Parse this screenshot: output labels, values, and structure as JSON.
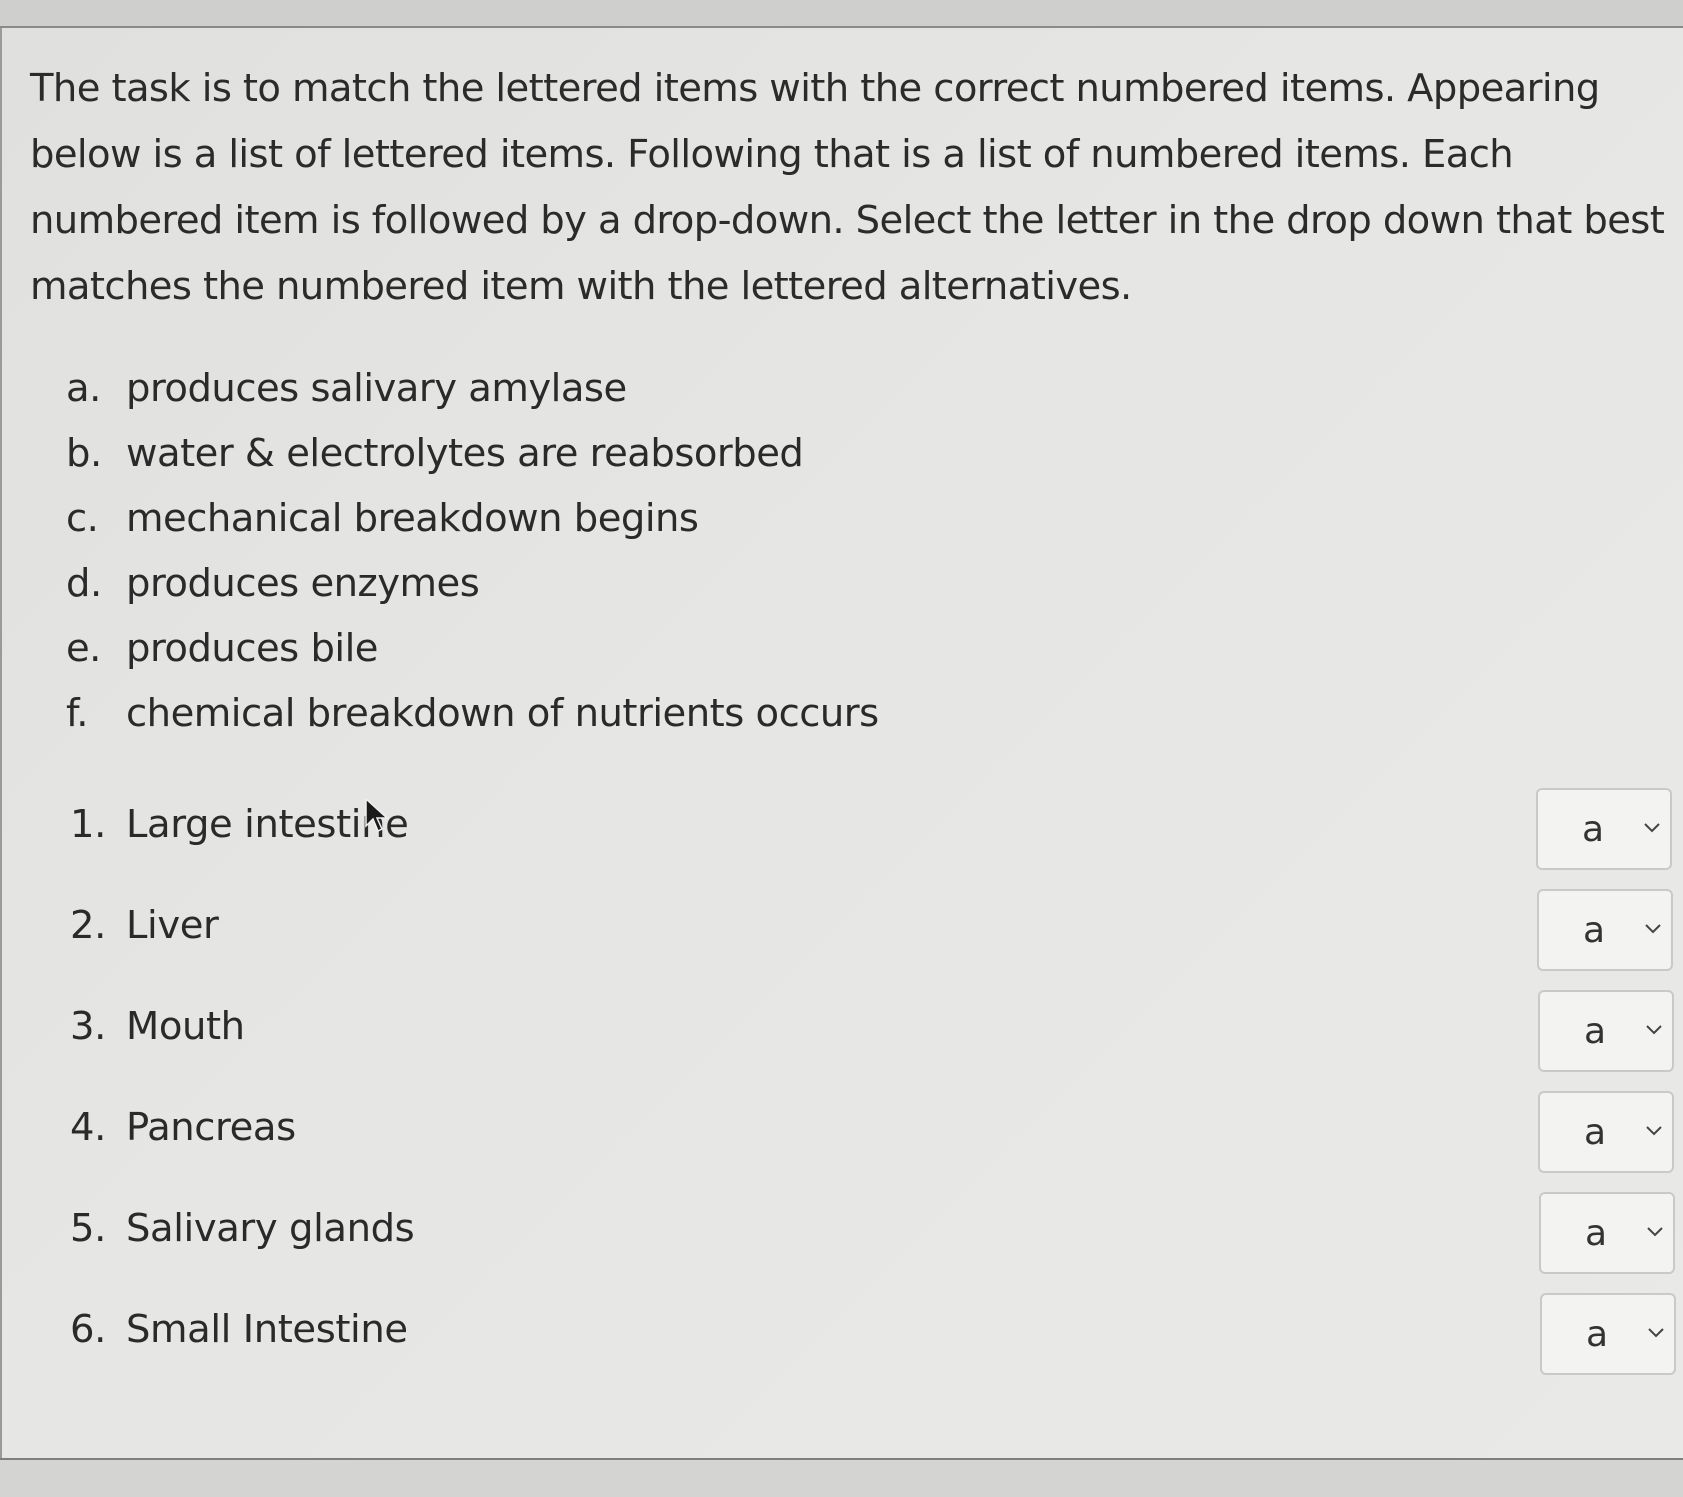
{
  "instructions": "The task is to match the lettered items with the correct numbered items. Appearing below is a list of lettered items. Following that is a list of numbered items. Each numbered item is followed by a drop-down. Select the letter in the drop down that best matches the numbered item with the lettered alternatives.",
  "lettered_items": [
    {
      "marker": "a.",
      "text": "produces salivary amylase"
    },
    {
      "marker": "b.",
      "text": "water & electrolytes are reabsorbed"
    },
    {
      "marker": "c.",
      "text": "mechanical breakdown begins"
    },
    {
      "marker": "d.",
      "text": "produces enzymes"
    },
    {
      "marker": "e.",
      "text": "produces bile"
    },
    {
      "marker": "f.",
      "text": "chemical breakdown of nutrients occurs"
    }
  ],
  "numbered_items": [
    {
      "marker": "1.",
      "text": "Large intestine",
      "selected": "a"
    },
    {
      "marker": "2.",
      "text": "Liver",
      "selected": "a"
    },
    {
      "marker": "3.",
      "text": "Mouth",
      "selected": "a"
    },
    {
      "marker": "4.",
      "text": "Pancreas",
      "selected": "a"
    },
    {
      "marker": "5.",
      "text": "Salivary glands",
      "selected": "a"
    },
    {
      "marker": "6.",
      "text": "Small Intestine",
      "selected": "a"
    }
  ],
  "icons": {
    "dropdown": "chevron-down-icon",
    "pointer": "mouse-cursor-icon"
  },
  "colors": {
    "text": "#2b2b2b",
    "panel": "#e6e6e4",
    "dropdown_bg": "#f3f3f1",
    "dropdown_border": "#c9c9c7"
  }
}
